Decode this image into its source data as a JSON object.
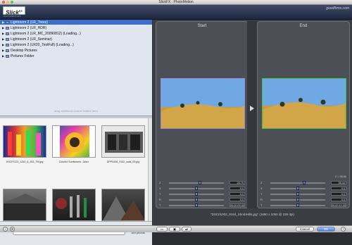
{
  "window": {
    "title": "SlickFX : PhotoMotion"
  },
  "header": {
    "logo": "Slick",
    "logo_sup": "FX",
    "subtitle": "PHOTOMOTION",
    "brand": "goodfirms.com"
  },
  "folders": [
    {
      "label": "Lightroom 2 (LR_Trees)",
      "selected": true
    },
    {
      "label": "Lightroom 2 (LR_HDR)",
      "selected": false
    },
    {
      "label": "Lightroom 2 (LR_MC_20090812) (Loading...)",
      "selected": false
    },
    {
      "label": "Lightroom 2 (LR_Seminar)",
      "selected": false
    },
    {
      "label": "Lightroom 2 (LR20_TestFull) (Loading...)",
      "selected": false
    },
    {
      "label": "Desktop Pictures",
      "selected": false
    },
    {
      "label": "Pictures Folder",
      "selected": false
    }
  ],
  "browser": {
    "hint": "drag additional source folders here",
    "photo_count": "189 photos",
    "search_placeholder": ""
  },
  "thumbnails": [
    {
      "caption": "DSCF0123_1240_8_253_TM.jpg"
    },
    {
      "caption": "Colorful Sunflowers - Macr"
    },
    {
      "caption": "DPP0438_9152_walk_05.jpg"
    },
    {
      "caption": ""
    },
    {
      "caption": ""
    },
    {
      "caption": ""
    }
  ],
  "start_panel": {
    "title": "Start",
    "sliders": [
      {
        "label": "Z",
        "value": "23.79",
        "pos": 0.55
      },
      {
        "label": "X",
        "value": "0.0",
        "pos": 0.5
      },
      {
        "label": "Y",
        "value": "0.0",
        "pos": 0.5
      },
      {
        "label": "R",
        "value": "0.0",
        "pos": 0.5
      },
      {
        "label": "T",
        "value": "00:00:00:00",
        "pos": 0.5
      }
    ]
  },
  "end_panel": {
    "title": "End",
    "zoom_label": "Z = 36.86",
    "sliders": [
      {
        "label": "Z",
        "value": "39.44",
        "pos": 0.6
      },
      {
        "label": "X",
        "value": "0.0",
        "pos": 0.5
      },
      {
        "label": "Y",
        "value": "0.0",
        "pos": 0.5
      },
      {
        "label": "R",
        "value": "0.0",
        "pos": 0.5
      },
      {
        "label": "T",
        "value": "00:00:10:00",
        "pos": 0.5
      }
    ]
  },
  "status": {
    "filename": "\"DSC01002_9184_ShrubHills.jpg\" (1680 x 1050 @ 336 dpi)"
  },
  "bottom": {
    "cancel": "Cancel",
    "ok": "OK",
    "help": "?"
  },
  "colors": {
    "end_border": "#3ec24a",
    "selection": "#3d6fc9",
    "accent": "#5b8ed8"
  }
}
